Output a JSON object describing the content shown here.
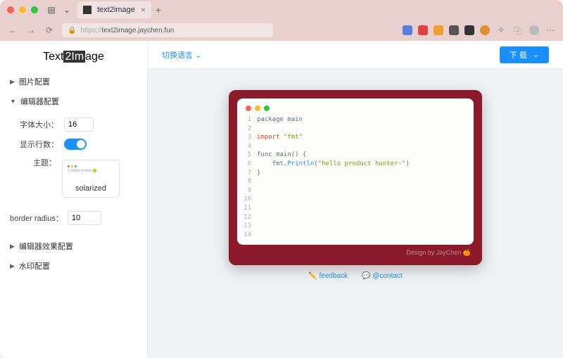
{
  "browser": {
    "tab_title": "text2image",
    "url_display": "https://text2image.jaychen.fun",
    "url_prefix": "https://"
  },
  "sidebar": {
    "logo_parts": [
      "Text",
      "2Im",
      "age"
    ],
    "sections": {
      "image": "图片配置",
      "editor": "编辑器配置",
      "effect": "编辑器效果配置",
      "watermark": "水印配置"
    },
    "fields": {
      "font_size_label": "字体大小：",
      "font_size_value": "16",
      "show_lines_label": "显示行数：",
      "theme_label": "主题：",
      "theme_name": "solarized",
      "theme_preview_text": "1 //write in here 😊",
      "border_radius_label": "border radius：",
      "border_radius_value": "10"
    }
  },
  "topbar": {
    "lang_label": "切换语言",
    "download_label": "下 载"
  },
  "code": {
    "lines": [
      {
        "n": "1",
        "html": "package main"
      },
      {
        "n": "2",
        "html": ""
      },
      {
        "n": "3",
        "html": "import \"fmt\""
      },
      {
        "n": "4",
        "html": ""
      },
      {
        "n": "5",
        "html": "func main() {"
      },
      {
        "n": "6",
        "html": "    fmt.Println(\"hello product hunter~\")"
      },
      {
        "n": "7",
        "html": "}"
      },
      {
        "n": "8",
        "html": ""
      },
      {
        "n": "9",
        "html": ""
      },
      {
        "n": "10",
        "html": ""
      },
      {
        "n": "11",
        "html": ""
      },
      {
        "n": "12",
        "html": ""
      },
      {
        "n": "13",
        "html": ""
      },
      {
        "n": "14",
        "html": ""
      }
    ],
    "credit": "Design by JayChen 🍊"
  },
  "footer": {
    "feedback": "feedback",
    "contact": "@contact"
  }
}
